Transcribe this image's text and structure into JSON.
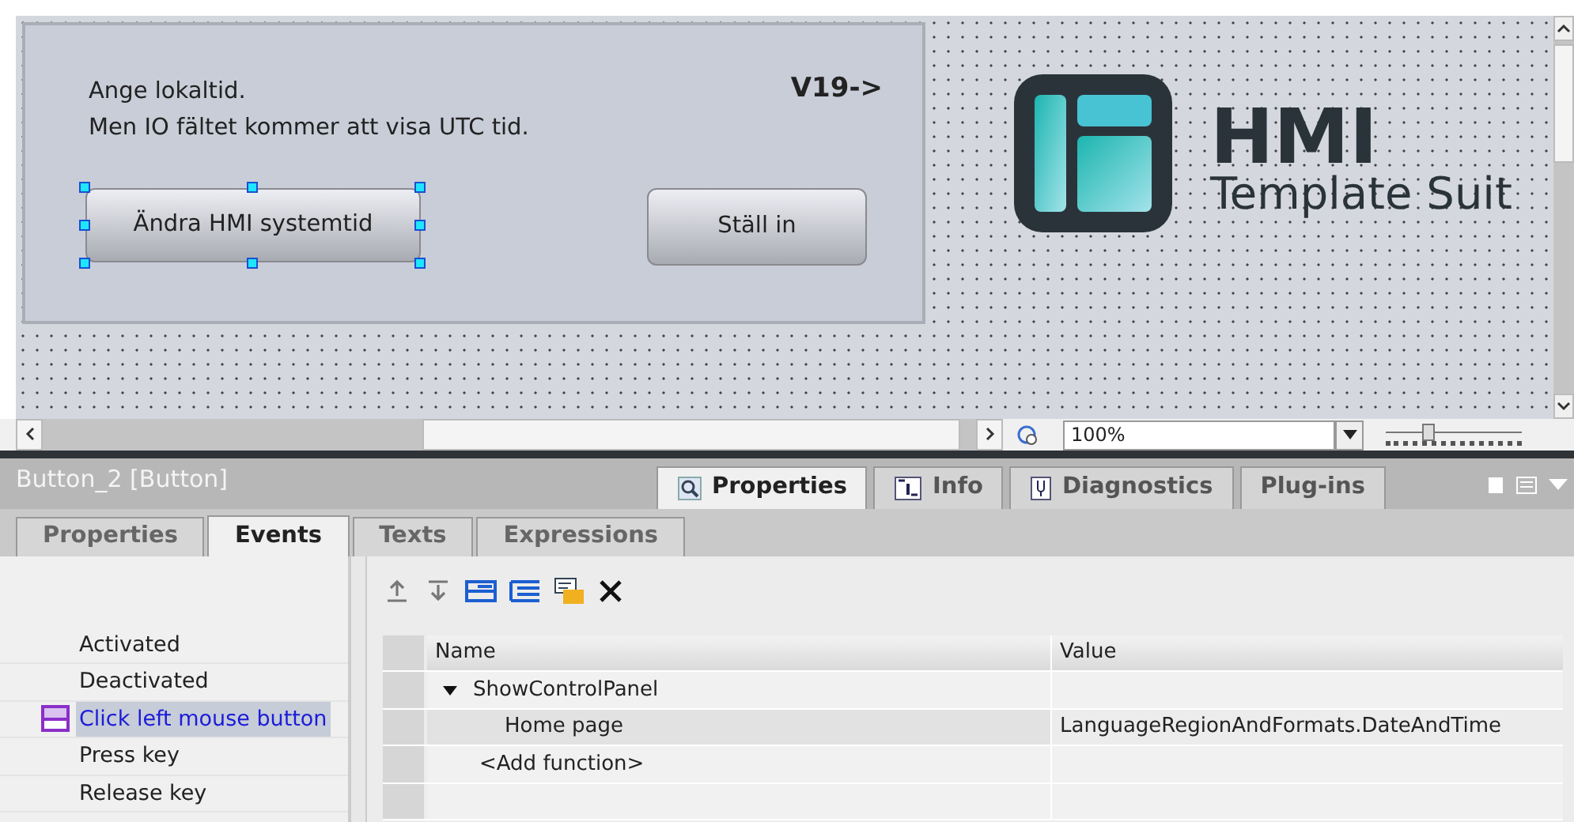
{
  "canvas": {
    "panel": {
      "text_lines": [
        "Ange lokaltid.",
        "Men IO fältet kommer att visa UTC tid."
      ],
      "version_label": "V19->",
      "buttons": [
        {
          "label": "Ändra HMI systemtid",
          "selected": true
        },
        {
          "label": "Ställ in",
          "selected": false
        }
      ]
    },
    "logo": {
      "title": "HMI",
      "subtitle": "Template Suit"
    }
  },
  "zoom": {
    "value": "100%",
    "level": 0.3
  },
  "inspector": {
    "title": "Button_2 [Button]",
    "main_tabs": [
      {
        "label": "Properties",
        "selected": true,
        "kind": "search"
      },
      {
        "label": "Info",
        "selected": false,
        "kind": "info"
      },
      {
        "label": "Diagnostics",
        "selected": false,
        "kind": "diagnostics"
      },
      {
        "label": "Plug-ins",
        "selected": false,
        "kind": "plain"
      }
    ],
    "sub_tabs": [
      {
        "label": "Properties",
        "selected": false
      },
      {
        "label": "Events",
        "selected": true
      },
      {
        "label": "Texts",
        "selected": false
      },
      {
        "label": "Expressions",
        "selected": false
      }
    ],
    "events": [
      {
        "label": "Activated",
        "selected": false,
        "has_function": false
      },
      {
        "label": "Deactivated",
        "selected": false,
        "has_function": false
      },
      {
        "label": "Click left mouse button",
        "selected": true,
        "has_function": true
      },
      {
        "label": "Press key",
        "selected": false,
        "has_function": false
      },
      {
        "label": "Release key",
        "selected": false,
        "has_function": false
      }
    ],
    "table": {
      "columns": [
        "Name",
        "Value"
      ],
      "rows": [
        {
          "name": "ShowControlPanel",
          "value": "",
          "expanded": true,
          "children": [
            {
              "name": "Home page",
              "value": "LanguageRegionAndFormats.DateAndTime"
            }
          ]
        },
        {
          "name": "<Add function>",
          "value": ""
        }
      ]
    }
  }
}
